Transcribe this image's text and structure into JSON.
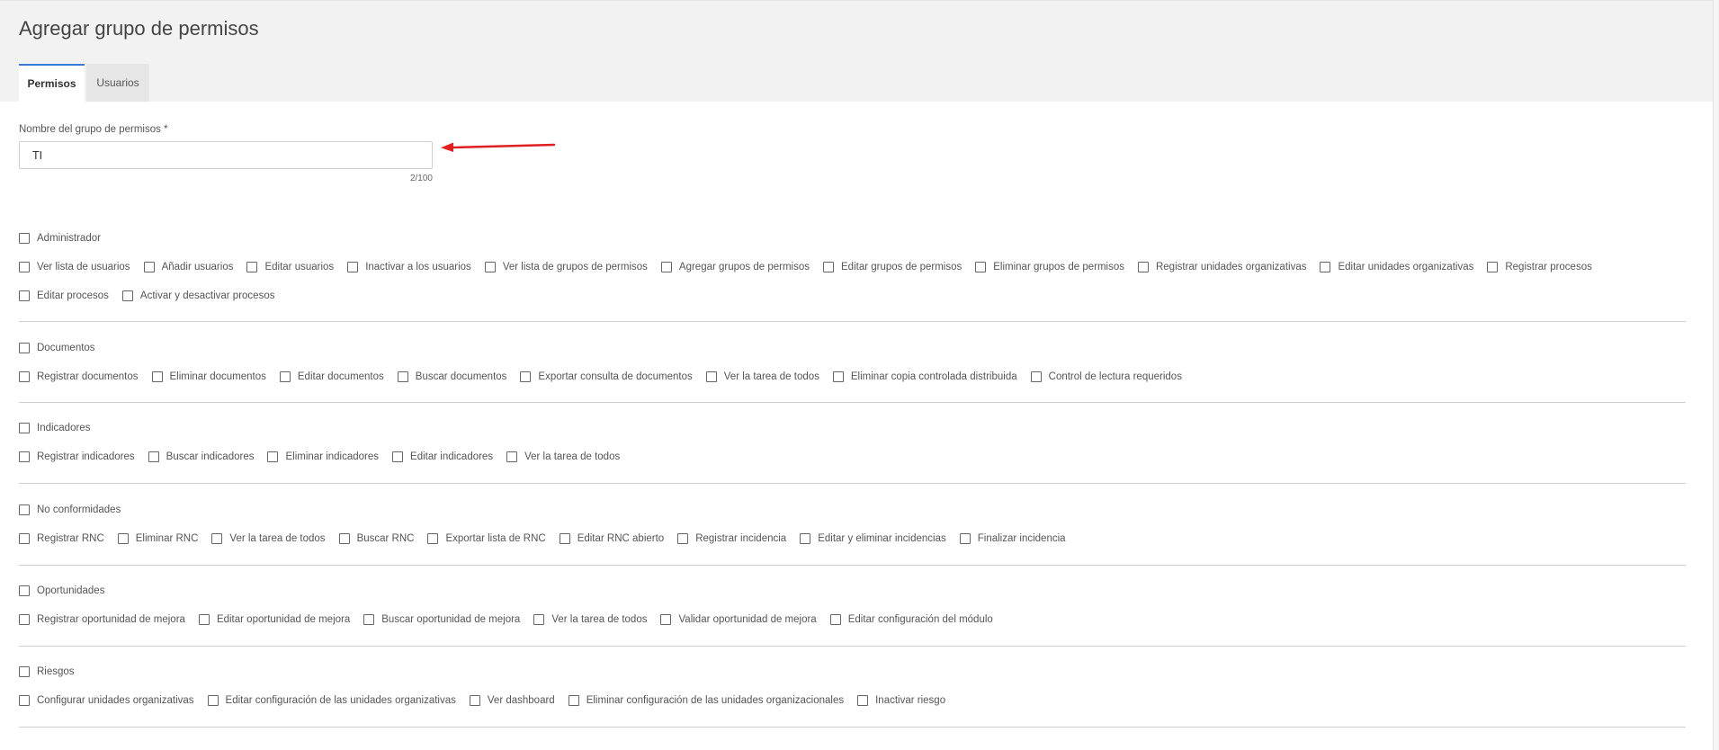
{
  "header": {
    "title": "Agregar grupo de permisos",
    "tabs": [
      {
        "label": "Permisos",
        "active": true
      },
      {
        "label": "Usuarios",
        "active": false
      }
    ]
  },
  "form": {
    "name_label": "Nombre del grupo de permisos *",
    "name_value": "TI",
    "counter": "2/100"
  },
  "colors": {
    "arrow": "#e02020",
    "active_tab_border": "#3a7bd5",
    "header_bg": "#f2f2f2"
  },
  "sections": {
    "admin": {
      "title": "Administrador",
      "row1": [
        "Ver lista de usuarios",
        "Añadir usuarios",
        "Editar usuarios",
        "Inactivar a los usuarios",
        "Ver lista de grupos de permisos",
        "Agregar grupos de permisos",
        "Editar grupos de permisos",
        "Eliminar grupos de permisos",
        "Registrar unidades organizativas",
        "Editar unidades organizativas",
        "Registrar procesos"
      ],
      "row2": [
        "Editar procesos",
        "Activar y desactivar procesos"
      ]
    },
    "docs": {
      "title": "Documentos",
      "row1": [
        "Registrar documentos",
        "Eliminar documentos",
        "Editar documentos",
        "Buscar documentos",
        "Exportar consulta de documentos",
        "Ver la tarea de todos",
        "Eliminar copia controlada distribuida",
        "Control de lectura requeridos"
      ]
    },
    "indicators": {
      "title": "Indicadores",
      "row1": [
        "Registrar indicadores",
        "Buscar indicadores",
        "Eliminar indicadores",
        "Editar indicadores",
        "Ver la tarea de todos"
      ]
    },
    "nonconf": {
      "title": "No conformidades",
      "row1": [
        "Registrar RNC",
        "Eliminar RNC",
        "Ver la tarea de todos",
        "Buscar RNC",
        "Exportar lista de RNC",
        "Editar RNC abierto",
        "Registrar incidencia",
        "Editar y eliminar incidencias",
        "Finalizar incidencia"
      ]
    },
    "opps": {
      "title": "Oportunidades",
      "row1": [
        "Registrar oportunidad de mejora",
        "Editar oportunidad de mejora",
        "Buscar oportunidad de mejora",
        "Ver la tarea de todos",
        "Validar oportunidad de mejora",
        "Editar configuración del módulo"
      ]
    },
    "risks": {
      "title": "Riesgos",
      "row1": [
        "Configurar unidades organizativas",
        "Editar configuración de las unidades organizativas",
        "Ver dashboard",
        "Eliminar configuración de las unidades organizacionales",
        "Inactivar riesgo"
      ]
    }
  }
}
